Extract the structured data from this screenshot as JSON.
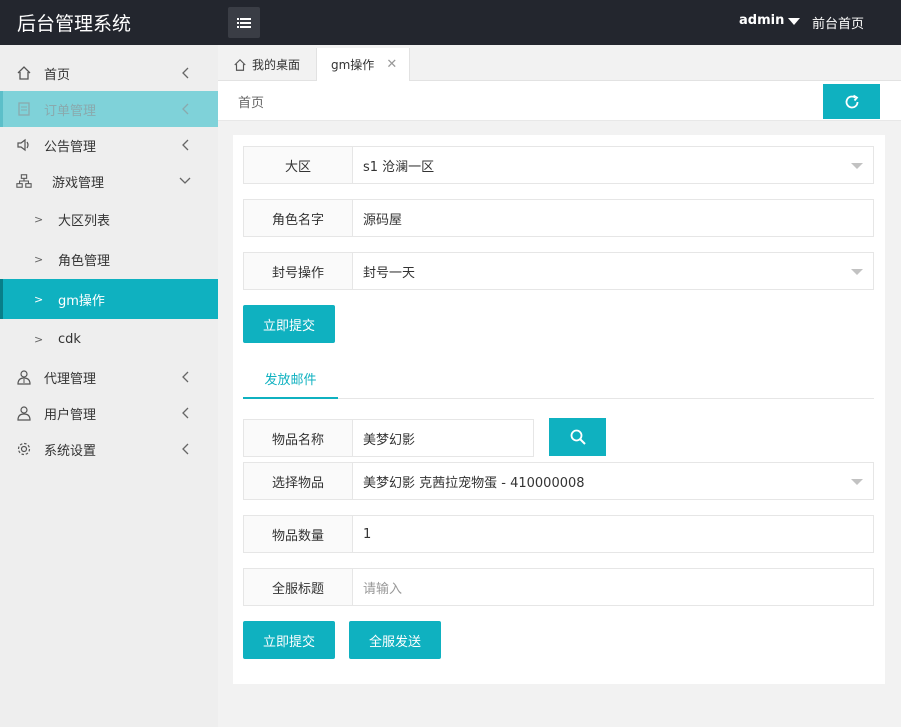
{
  "header": {
    "title": "后台管理系统",
    "user": "admin",
    "front_link": "前台首页"
  },
  "sidebar": {
    "items": [
      {
        "label": "首页",
        "icon": "home-icon"
      },
      {
        "label": "订单管理",
        "icon": "document-icon"
      },
      {
        "label": "公告管理",
        "icon": "speaker-icon"
      },
      {
        "label": "游戏管理",
        "icon": "sitemap-icon"
      },
      {
        "label": "代理管理",
        "icon": "users-icon"
      },
      {
        "label": "用户管理",
        "icon": "user-icon"
      },
      {
        "label": "系统设置",
        "icon": "gear-icon"
      }
    ],
    "sub_items": [
      {
        "label": "大区列表"
      },
      {
        "label": "角色管理"
      },
      {
        "label": "gm操作"
      },
      {
        "label": "cdk"
      }
    ]
  },
  "tabs": [
    {
      "label": "我的桌面"
    },
    {
      "label": "gm操作"
    }
  ],
  "breadcrumb": "首页",
  "form1": {
    "region_label": "大区",
    "region_value": "s1 沧澜一区",
    "role_label": "角色名字",
    "role_value": "源码屋",
    "ban_label": "封号操作",
    "ban_value": "封号一天",
    "submit_label": "立即提交"
  },
  "mail": {
    "tab_label": "发放邮件",
    "item_name_label": "物品名称",
    "item_name_value": "美梦幻影",
    "select_item_label": "选择物品",
    "select_item_value": "美梦幻影 克茜拉宠物蛋 - 410000008",
    "qty_label": "物品数量",
    "qty_value": "1",
    "title_label": "全服标题",
    "title_placeholder": "请输入",
    "submit_label": "立即提交",
    "broadcast_label": "全服发送"
  },
  "colors": {
    "accent": "#0fb1c0",
    "header_bg": "#23262e",
    "sidebar_bg": "#eeeeee",
    "highlight_bg": "#7fd2d9"
  }
}
